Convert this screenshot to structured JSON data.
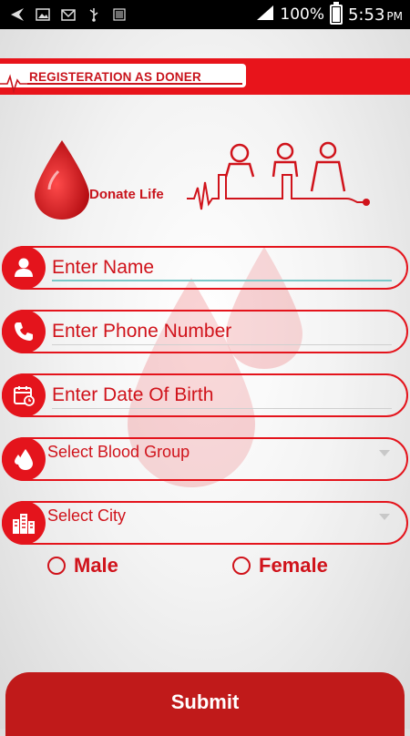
{
  "status_bar": {
    "battery": "100%",
    "time": "5:53",
    "ampm": "PM",
    "icons": [
      "back-arrow-icon",
      "image-icon",
      "gmail-icon",
      "usb-icon",
      "barcode-icon",
      "signal-icon",
      "battery-icon"
    ]
  },
  "header": {
    "title": "REGISTERATION AS DONER"
  },
  "logo": {
    "text": "Donate Life"
  },
  "form": {
    "name_placeholder": "Enter Name",
    "phone_placeholder": "Enter Phone Number",
    "dob_placeholder": "Enter Date Of Birth",
    "blood_group_label": "Select Blood Group",
    "city_label": "Select City"
  },
  "gender": {
    "male": "Male",
    "female": "Female"
  },
  "submit_label": "Submit",
  "colors": {
    "primary": "#e4141c",
    "dark_red": "#c01a1a",
    "active_underline": "#7cc9c9"
  }
}
